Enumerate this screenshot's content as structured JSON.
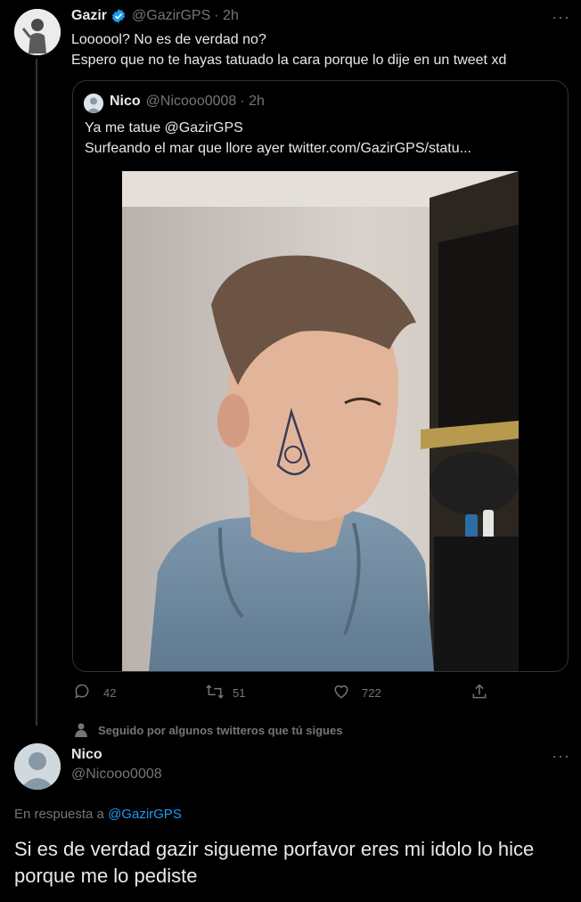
{
  "tweet": {
    "author_name": "Gazir",
    "author_handle": "@GazirGPS",
    "time": "· 2h",
    "verified": true,
    "text_line1": "Loooool? No es de verdad no?",
    "text_line2": "Espero que no te hayas tatuado la cara porque lo dije en un tweet xd",
    "more_label": "···"
  },
  "quote": {
    "author_name": "Nico",
    "author_handle": "@Nicooo0008",
    "time": "· 2h",
    "text_line1": "Ya me tatue @GazirGPS",
    "text_line2": "Surfeando el mar que llore ayer  twitter.com/GazirGPS/statu..."
  },
  "actions": {
    "replies": "42",
    "retweets": "51",
    "likes": "722"
  },
  "social_context": "Seguido por algunos twitteros que tú sigues",
  "reply": {
    "author_name": "Nico",
    "author_handle": "@Nicooo0008",
    "more_label": "···",
    "in_reply_prefix": "En respuesta a",
    "in_reply_handle": "@GazirGPS",
    "text": "Si es de verdad gazir sigueme porfavor eres mi idolo lo hice porque me lo pediste"
  },
  "colors": {
    "background": "#000000",
    "text": "#e7e9ea",
    "muted": "#71767b",
    "accent": "#1d9bf0",
    "border": "#2f3336"
  }
}
